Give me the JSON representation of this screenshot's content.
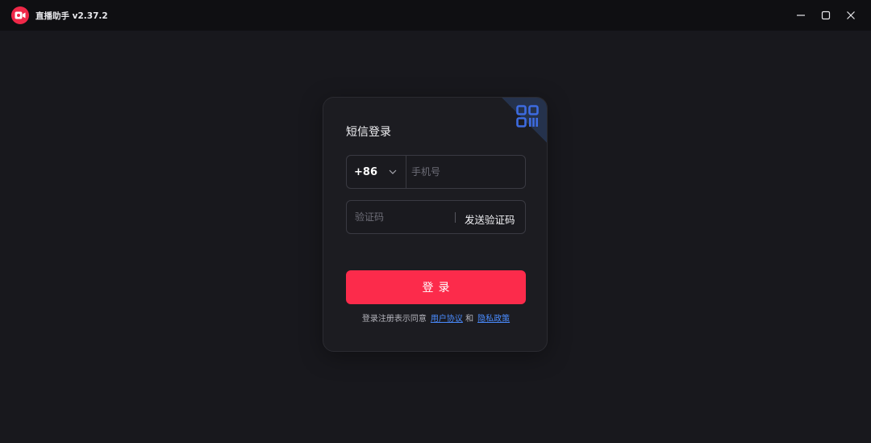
{
  "titlebar": {
    "app_name": "直播助手 v2.37.2",
    "logo_icon": "camera-icon",
    "logo_color": "#ef2848",
    "controls": [
      "minimize-icon",
      "maximize-icon",
      "close-icon"
    ]
  },
  "login": {
    "title": "短信登录",
    "qr_icon": "qr-code-icon",
    "country_code": "+86",
    "phone_placeholder": "手机号",
    "code_placeholder": "验证码",
    "send_code_label": "发送验证码",
    "submit_label": "登录",
    "agreement": {
      "prefix": "登录注册表示同意",
      "user_agreement": "用户协议",
      "conjunction": "和",
      "privacy_policy": "隐私政策"
    }
  },
  "colors": {
    "background": "#18181d",
    "titlebar": "#0f0f12",
    "accent": "#fc2b4b",
    "link": "#4a8cff",
    "qr": "#3d6be0"
  }
}
